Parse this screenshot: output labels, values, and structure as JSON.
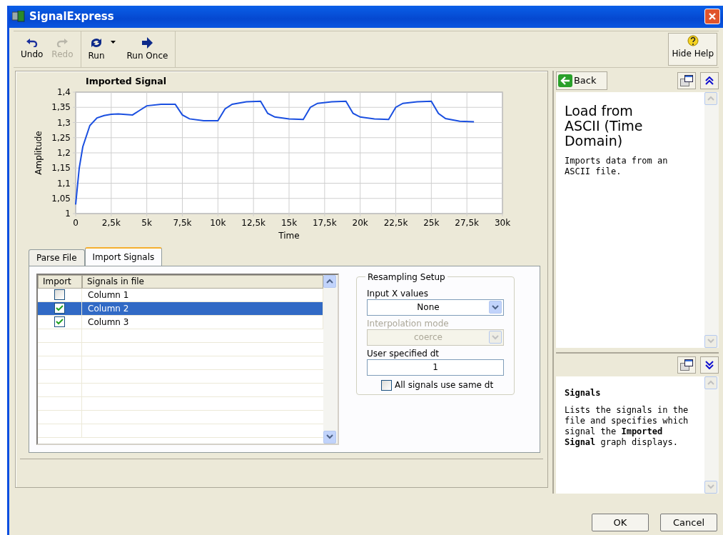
{
  "window": {
    "title": "SignalExpress"
  },
  "toolbar": {
    "buttons": [
      {
        "label": "Undo",
        "disabled": false
      },
      {
        "label": "Redo",
        "disabled": true
      },
      {
        "label": "Run",
        "disabled": false,
        "dropdown": true
      },
      {
        "label": "Run Once",
        "disabled": false,
        "dropdown": false
      }
    ],
    "help_button": {
      "label": "Hide Help"
    }
  },
  "graph": {
    "title": "Imported Signal",
    "chart_data": {
      "type": "line",
      "grid": true,
      "xlabel": "Time",
      "ylabel": "Amplitude",
      "xlim": [
        0,
        30000
      ],
      "ylim": [
        1,
        1.4
      ],
      "xticks": [
        {
          "value": 0,
          "label": "0"
        },
        {
          "value": 2500,
          "label": "2,5k"
        },
        {
          "value": 5000,
          "label": "5k"
        },
        {
          "value": 7500,
          "label": "7,5k"
        },
        {
          "value": 10000,
          "label": "10k"
        },
        {
          "value": 12500,
          "label": "12,5k"
        },
        {
          "value": 15000,
          "label": "15k"
        },
        {
          "value": 17500,
          "label": "17,5k"
        },
        {
          "value": 20000,
          "label": "20k"
        },
        {
          "value": 22500,
          "label": "22,5k"
        },
        {
          "value": 25000,
          "label": "25k"
        },
        {
          "value": 27500,
          "label": "27,5k"
        },
        {
          "value": 30000,
          "label": "30k"
        }
      ],
      "yticks": [
        {
          "value": 1,
          "label": "1"
        },
        {
          "value": 1.05,
          "label": "1,05"
        },
        {
          "value": 1.1,
          "label": "1,1"
        },
        {
          "value": 1.15,
          "label": "1,15"
        },
        {
          "value": 1.2,
          "label": "1,2"
        },
        {
          "value": 1.25,
          "label": "1,25"
        },
        {
          "value": 1.3,
          "label": "1,3"
        },
        {
          "value": 1.35,
          "label": "1,35"
        },
        {
          "value": 1.4,
          "label": "1,4"
        }
      ],
      "x": [
        0,
        250,
        500,
        1000,
        1500,
        2000,
        2500,
        3000,
        4000,
        4500,
        5000,
        6000,
        7000,
        7500,
        8000,
        9000,
        10000,
        10500,
        11000,
        12000,
        13000,
        13500,
        14000,
        15000,
        16000,
        16500,
        17000,
        18000,
        19000,
        19500,
        20000,
        21000,
        22000,
        22500,
        23000,
        24000,
        25000,
        25500,
        26000,
        27000,
        28000
      ],
      "series": [
        {
          "color": "#1a4fe0",
          "values": [
            1.03,
            1.15,
            1.22,
            1.29,
            1.315,
            1.323,
            1.327,
            1.328,
            1.325,
            1.34,
            1.355,
            1.36,
            1.36,
            1.325,
            1.312,
            1.306,
            1.306,
            1.345,
            1.36,
            1.368,
            1.37,
            1.33,
            1.318,
            1.312,
            1.31,
            1.35,
            1.363,
            1.368,
            1.37,
            1.33,
            1.318,
            1.312,
            1.31,
            1.35,
            1.363,
            1.368,
            1.37,
            1.33,
            1.313,
            1.304,
            1.302
          ]
        }
      ]
    }
  },
  "tabs": [
    {
      "label": "Parse File",
      "selected": false
    },
    {
      "label": "Import Signals",
      "selected": true
    }
  ],
  "signals_table": {
    "columns": [
      "Import",
      "Signals in file"
    ],
    "rows": [
      {
        "name": "Column  1",
        "checked": false,
        "selected": false
      },
      {
        "name": "Column  2",
        "checked": true,
        "selected": true
      },
      {
        "name": "Column  3",
        "checked": true,
        "selected": false
      }
    ]
  },
  "resampling": {
    "title": "Resampling Setup",
    "input_x": {
      "label": "Input X values",
      "value": "None",
      "disabled": false
    },
    "interpolation": {
      "label": "Interpolation mode",
      "value": "coerce",
      "disabled": true
    },
    "dt": {
      "label": "User specified dt",
      "value": "1"
    },
    "same_dt": {
      "label": "All signals use same dt",
      "checked": false
    }
  },
  "help": {
    "back": "Back",
    "title": "Load from ASCII (Time Domain)",
    "description": "Imports data from an ASCII file.",
    "context_title": "Signals",
    "context_text": "Lists the signals in the file and specifies which signal the **Imported Signal** graph displays."
  },
  "buttons": [
    "OK",
    "Cancel"
  ]
}
